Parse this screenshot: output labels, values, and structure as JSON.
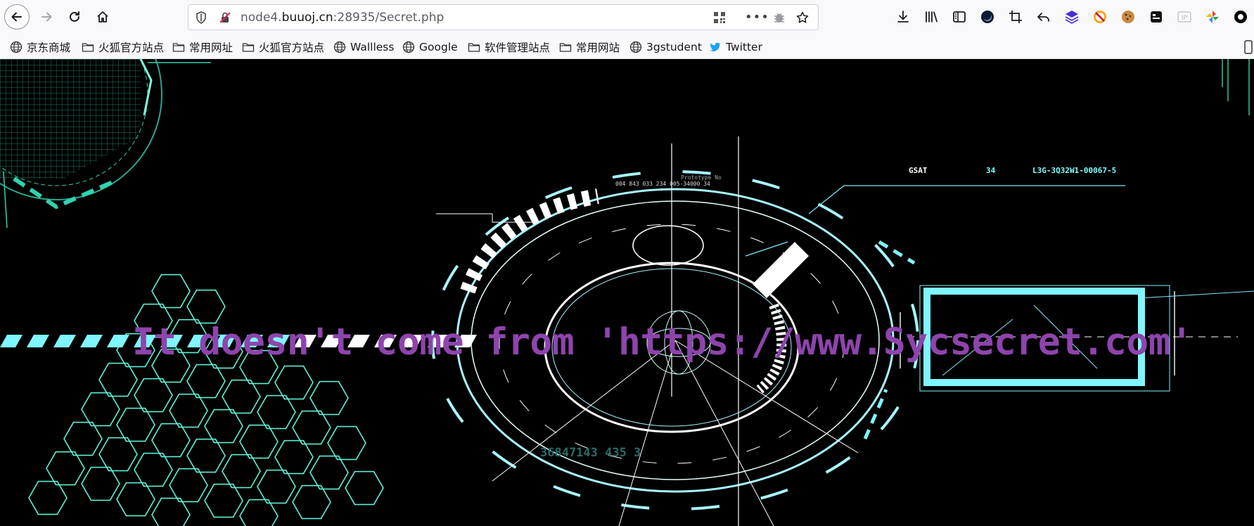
{
  "browser": {
    "url_prefix": "node4.",
    "url_host": "buuoj.cn",
    "url_suffix": ":28935/Secret.php"
  },
  "bookmarks": [
    {
      "label": "京东商城",
      "icon": "globe-icon"
    },
    {
      "label": "火狐官方站点",
      "icon": "folder-icon"
    },
    {
      "label": "常用网址",
      "icon": "folder-icon"
    },
    {
      "label": "火狐官方站点",
      "icon": "folder-icon"
    },
    {
      "label": "Wallless",
      "icon": "globe-icon"
    },
    {
      "label": "Google",
      "icon": "globe-icon"
    },
    {
      "label": "软件管理站点",
      "icon": "folder-icon"
    },
    {
      "label": "常用网站",
      "icon": "folder-icon"
    },
    {
      "label": "3gstudent",
      "icon": "globe-icon"
    },
    {
      "label": "Twitter",
      "icon": "twitter-icon"
    }
  ],
  "page": {
    "message": "It doesn't come from 'https://www.Sycsecret.com'",
    "hud_label_left": "GSAT",
    "hud_label_mid": "34",
    "hud_label_right": "L3G-3Q32W1-00067-5",
    "hud_prototype": "Prototype No",
    "hud_numbers": "004 843 033 234 005-34000 34",
    "hud_bottom": "36847143 435 3"
  },
  "colors": {
    "message": "#8e44ad",
    "hud": "#7fffff",
    "background": "#000000"
  }
}
